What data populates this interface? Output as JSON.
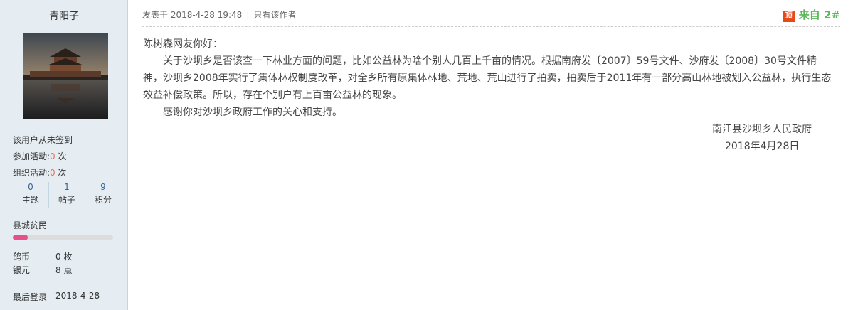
{
  "user": {
    "name": "青阳子",
    "sign_status": "该用户从未签到",
    "join_activity_label": "参加活动:",
    "join_activity_count": "0",
    "join_activity_unit": " 次",
    "org_activity_label": "组织活动:",
    "org_activity_count": "0",
    "org_activity_unit": " 次",
    "stats": [
      {
        "value": "0",
        "label": "主题"
      },
      {
        "value": "1",
        "label": "帖子"
      },
      {
        "value": "9",
        "label": "积分"
      }
    ],
    "group": "县城贫民",
    "group_progress": 0.15,
    "coin_label": "鸽币",
    "coin_value": "0 枚",
    "silver_label": "银元",
    "silver_value": "8 点",
    "last_login_label": "最后登录",
    "last_login_value": "2018-4-28"
  },
  "post": {
    "posted_at": "发表于 2018-4-28 19:48",
    "author_only": "只看该作者",
    "top_badge": "顶",
    "floor": "来自 2#",
    "greeting": "陈树森网友你好：",
    "paragraph1": "关于沙坝乡是否该查一下林业方面的问题，比如公益林为啥个别人几百上千亩的情况。根据南府发〔2007〕59号文件、沙府发〔2008〕30号文件精神，沙坝乡2008年实行了集体林权制度改革，对全乡所有原集体林地、荒地、荒山进行了拍卖，拍卖后于2011年有一部分高山林地被划入公益林，执行生态效益补偿政策。所以，存在个别户有上百亩公益林的现象。",
    "paragraph2": "感谢你对沙坝乡政府工作的关心和支持。",
    "sign_org": "南江县沙坝乡人民政府",
    "sign_date": "2018年4月28日"
  },
  "colors": {
    "accent_red": "#f26c4f",
    "floor_green": "#5bb75b",
    "sidebar_bg": "#e5edf2",
    "progress_pink": "#e8508c"
  }
}
